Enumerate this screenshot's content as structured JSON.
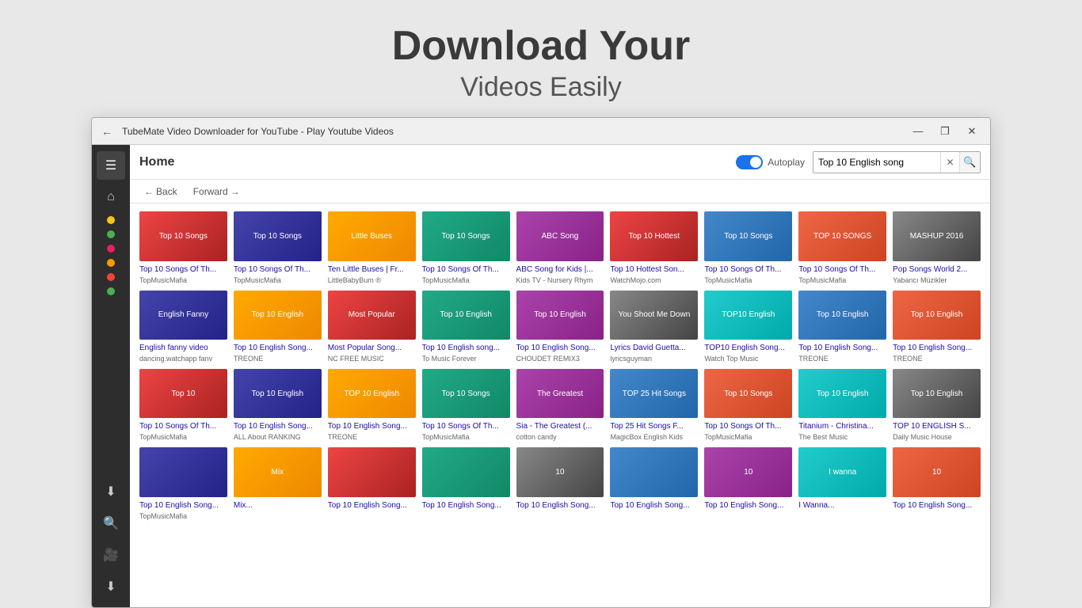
{
  "hero": {
    "title": "Download Your",
    "subtitle": "Videos Easily"
  },
  "window": {
    "titlebar": {
      "title": "TubeMate Video Downloader for YouTube - Play Youtube Videos",
      "minimize": "—",
      "maximize": "❐",
      "close": "✕"
    },
    "topbar": {
      "home_label": "Home",
      "autoplay_label": "Autoplay",
      "search_value": "Top 10 English song"
    },
    "nav": {
      "back_label": "Back",
      "forward_label": "Forward"
    },
    "sidebar_icons": {
      "menu": "☰",
      "home": "⌂",
      "download": "⬇",
      "search": "🔍",
      "camera": "🎥",
      "down2": "⬇"
    },
    "dots": [
      "#f5c518",
      "#4caf50",
      "#e91e63",
      "#ff9800",
      "#f44336",
      "#4caf50"
    ],
    "videos": [
      {
        "title": "Top 10 Songs Of Th...",
        "channel": "TopMusicMafia",
        "color": "c1",
        "label": "Top 10\nSongs"
      },
      {
        "title": "Top 10 Songs Of Th...",
        "channel": "TopMusicMafia",
        "color": "c2",
        "label": "Top 10\nSongs"
      },
      {
        "title": "Ten Little Buses | Fr...",
        "channel": "LittleBabyBum ®",
        "color": "c3",
        "label": "Little\nBuses"
      },
      {
        "title": "Top 10 Songs Of Th...",
        "channel": "TopMusicMafia",
        "color": "c4",
        "label": "Top 10\nSongs"
      },
      {
        "title": "ABC Song for Kids |...",
        "channel": "Kids TV - Nursery Rhym",
        "color": "c5",
        "label": "ABC\nSong"
      },
      {
        "title": "Top 10 Hottest Son...",
        "channel": "WatchMojo.com",
        "color": "c1",
        "label": "Top 10\nHottest"
      },
      {
        "title": "Top 10 Songs Of Th...",
        "channel": "TopMusicMafia",
        "color": "c6",
        "label": "Top 10\nSongs"
      },
      {
        "title": "Top 10 Songs Of Th...",
        "channel": "TopMusicMafia",
        "color": "c7",
        "label": "TOP 10\nSONGS"
      },
      {
        "title": "Pop Songs World 2...",
        "channel": "Yabancı Müzikler",
        "color": "c9",
        "label": "MASHUP\n2016"
      },
      {
        "title": "English fanny video",
        "channel": "dancing.watchapp fanv",
        "color": "c2",
        "label": "English\nFanny"
      },
      {
        "title": "Top 10 English Song...",
        "channel": "TREONE",
        "color": "c3",
        "label": "Top 10\nEnglish"
      },
      {
        "title": "Most Popular Song...",
        "channel": "NC FREE MUSIC",
        "color": "c1",
        "label": "Most\nPopular"
      },
      {
        "title": "Top 10 English song...",
        "channel": "To Music Forever",
        "color": "c4",
        "label": "Top 10\nEnglish"
      },
      {
        "title": "Top 10 English Song...",
        "channel": "CHOUDET REMIX3",
        "color": "c5",
        "label": "Top 10\nEnglish"
      },
      {
        "title": "Lyrics David Guetta...",
        "channel": "lyricsguyman",
        "color": "c9",
        "label": "You Shoot\nMe Down"
      },
      {
        "title": "TOP10 English Song...",
        "channel": "Watch Top Music",
        "color": "c8",
        "label": "TOP10\nEnglish"
      },
      {
        "title": "Top 10 English Song...",
        "channel": "TREONE",
        "color": "c6",
        "label": "Top 10\nEnglish"
      },
      {
        "title": "Top 10 English Song...",
        "channel": "TREONE",
        "color": "c7",
        "label": "Top 10\nEnglish"
      },
      {
        "title": "Top 10 Songs Of Th...",
        "channel": "TopMusicMafia",
        "color": "c1",
        "label": "Top 10"
      },
      {
        "title": "Top 10 English Song...",
        "channel": "ALL About RANKING",
        "color": "c2",
        "label": "Top 10\nEnglish"
      },
      {
        "title": "Top 10 English Song...",
        "channel": "TREONE",
        "color": "c3",
        "label": "TOP 10\nEnglish"
      },
      {
        "title": "Top 10 Songs Of Th...",
        "channel": "TopMusicMafia",
        "color": "c4",
        "label": "Top 10\nSongs"
      },
      {
        "title": "Sia - The Greatest (...",
        "channel": "cotton candy",
        "color": "c5",
        "label": "The\nGreatest"
      },
      {
        "title": "Top 25 Hit Songs F...",
        "channel": "MagicBox English Kids",
        "color": "c6",
        "label": "TOP 25\nHit Songs"
      },
      {
        "title": "Top 10 Songs Of Th...",
        "channel": "TopMusicMafia",
        "color": "c7",
        "label": "Top 10\nSongs"
      },
      {
        "title": "Titanium - Christina...",
        "channel": "The Best Music",
        "color": "c8",
        "label": "Top 10\nEnglish"
      },
      {
        "title": "TOP 10 ENGLISH S...",
        "channel": "Daily Music House",
        "color": "c9",
        "label": "Top 10\nEnglish"
      },
      {
        "title": "Top 10 English Song...",
        "channel": "TopMusicMafia",
        "color": "c2",
        "label": ""
      },
      {
        "title": "Mix...",
        "channel": "",
        "color": "c3",
        "label": "Mix"
      },
      {
        "title": "Top 10 English Song...",
        "channel": "",
        "color": "c1",
        "label": ""
      },
      {
        "title": "Top 10 English Song...",
        "channel": "",
        "color": "c4",
        "label": ""
      },
      {
        "title": "Top 10 English Song...",
        "channel": "",
        "color": "c9",
        "label": "10"
      },
      {
        "title": "Top 10 English Song...",
        "channel": "",
        "color": "c6",
        "label": ""
      },
      {
        "title": "Top 10 English Song...",
        "channel": "",
        "color": "c5",
        "label": "10"
      },
      {
        "title": "I Wanna...",
        "channel": "",
        "color": "c8",
        "label": "I wanna"
      },
      {
        "title": "Top 10 English Song...",
        "channel": "",
        "color": "c7",
        "label": "10"
      }
    ]
  }
}
